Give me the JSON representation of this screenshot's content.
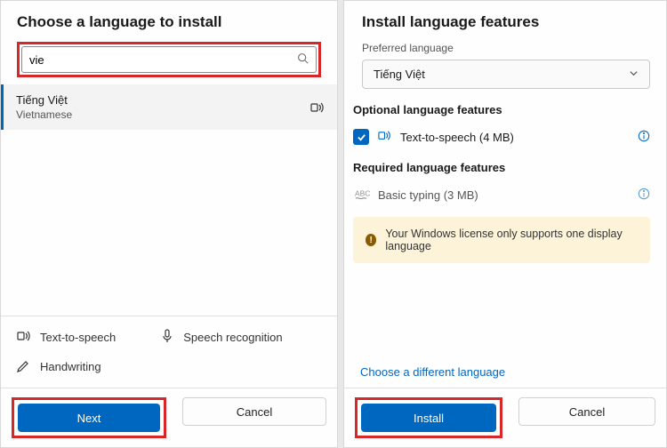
{
  "left": {
    "title": "Choose a language to install",
    "search": {
      "value": "vie",
      "placeholder": ""
    },
    "result": {
      "native": "Tiếng Việt",
      "english": "Vietnamese"
    },
    "legend": {
      "tts": "Text-to-speech",
      "speech": "Speech recognition",
      "handwriting": "Handwriting"
    },
    "next": "Next",
    "cancel": "Cancel"
  },
  "right": {
    "title": "Install language features",
    "preferred_label": "Preferred language",
    "preferred_value": "Tiếng Việt",
    "optional_head": "Optional language features",
    "tts_label": "Text-to-speech (4 MB)",
    "required_head": "Required language features",
    "basic_label": "Basic typing (3 MB)",
    "warning": "Your Windows license only supports one display language",
    "different": "Choose a different language",
    "install": "Install",
    "cancel": "Cancel"
  }
}
